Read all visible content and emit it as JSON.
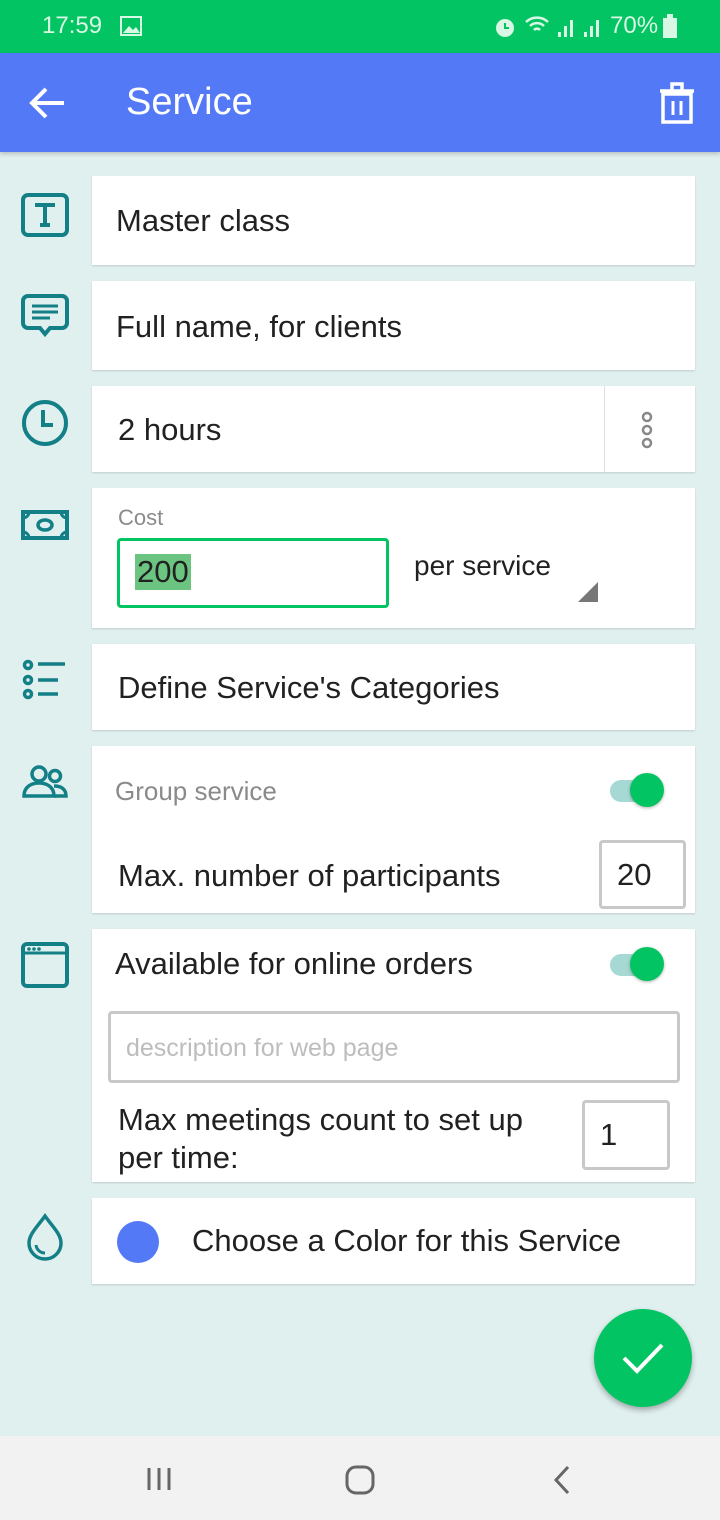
{
  "status": {
    "time": "17:59",
    "battery": "70%",
    "icons": [
      "image-icon",
      "alarm-icon",
      "wifi-icon",
      "signal-icon",
      "signal-icon",
      "battery-icon"
    ]
  },
  "appbar": {
    "title": "Service"
  },
  "name": {
    "value": "Master class"
  },
  "full_name": {
    "placeholder": "Full name, for clients"
  },
  "duration": {
    "value": "2 hours"
  },
  "cost": {
    "label": "Cost",
    "value": "200",
    "unit": "per service"
  },
  "categories": {
    "placeholder": "Define Service's Categories"
  },
  "group": {
    "label": "Group service",
    "enabled": true,
    "max_label": "Max. number of participants",
    "max_value": "20"
  },
  "online": {
    "label": "Available for online orders",
    "enabled": true,
    "description_placeholder": "description for web page",
    "max_meetings_label": "Max meetings count to set up per time:",
    "max_meetings_value": "1"
  },
  "color": {
    "label": "Choose a Color for this Service",
    "value": "#5479f7"
  },
  "colors": {
    "accent": "#03c462",
    "appbar": "#5479f7",
    "icon": "#137f86",
    "background": "#e0f0ef"
  }
}
